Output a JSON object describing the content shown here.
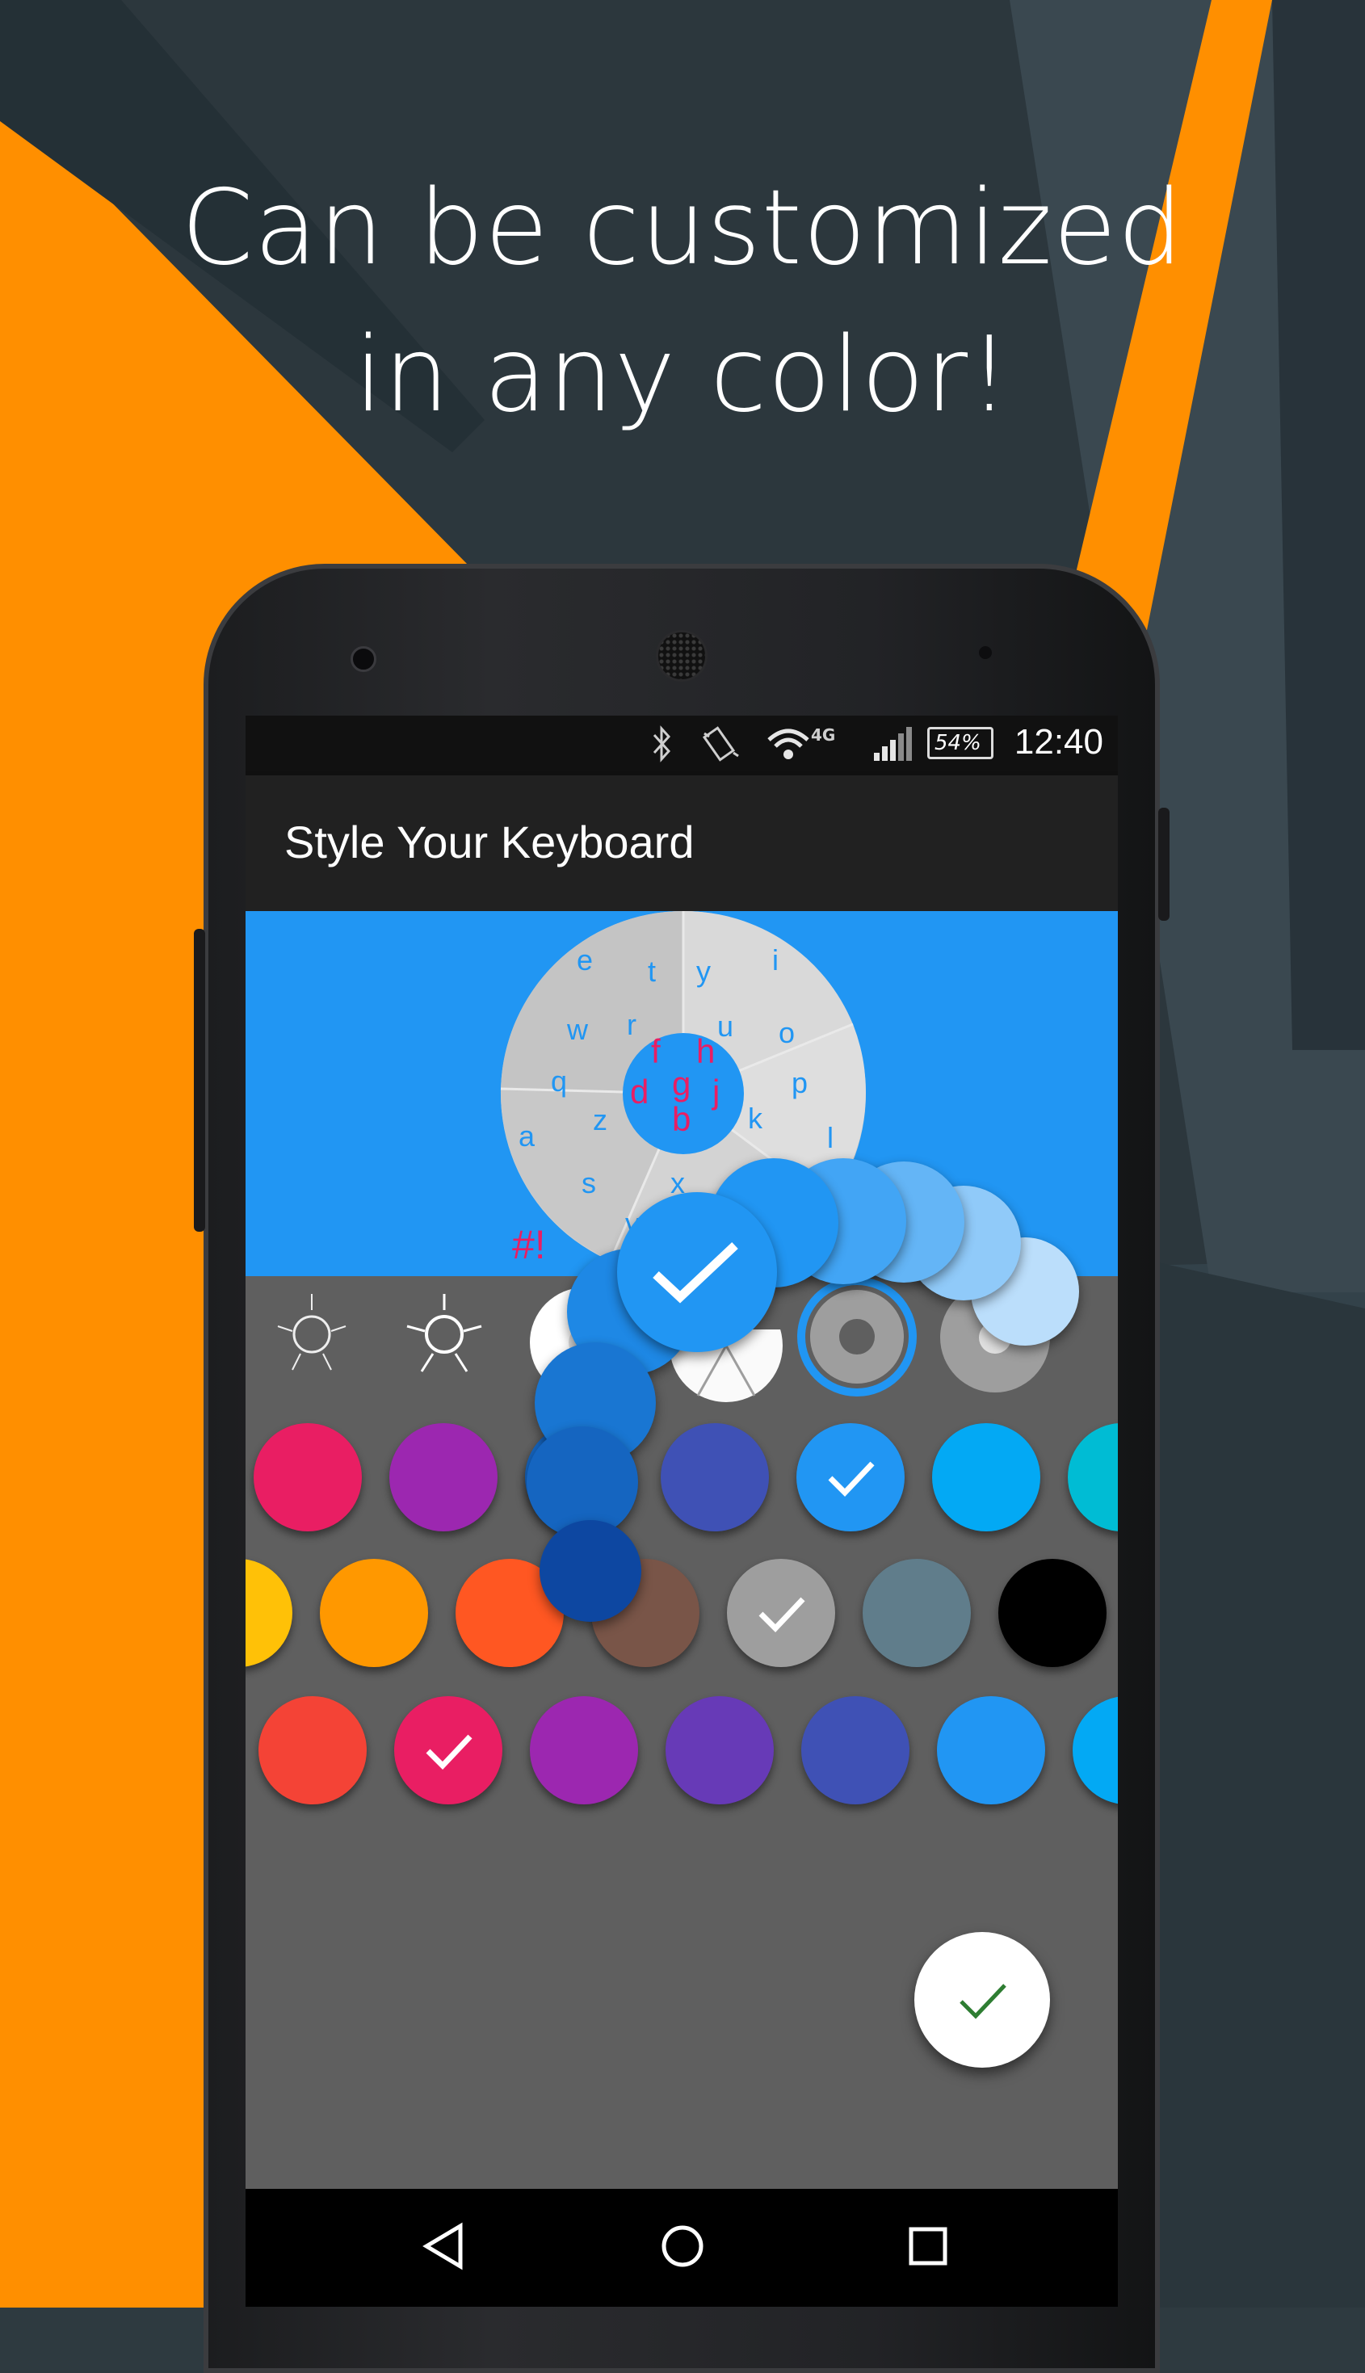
{
  "headline": {
    "line1": "Can be customized",
    "line2": "in any color!"
  },
  "status_bar": {
    "time": "12:40",
    "battery": "54%",
    "network": "4G"
  },
  "app_bar": {
    "title": "Style Your Keyboard"
  },
  "keyboard_preview": {
    "outer_letters": [
      "e",
      "t",
      "y",
      "i",
      "w",
      "r",
      "u",
      "o",
      "q",
      "p",
      "a",
      "z",
      "k",
      "l",
      "s",
      "x",
      "v"
    ],
    "center_letters": [
      "f",
      "h",
      "d",
      "g",
      "j",
      "b"
    ],
    "symbols_key": "#!"
  },
  "style_options": [
    {
      "name": "light-theme-outline",
      "selected": false
    },
    {
      "name": "light-theme-outline-2",
      "selected": false
    },
    {
      "name": "white-wheel",
      "selected": false
    },
    {
      "name": "white-wheel-2",
      "selected": false
    },
    {
      "name": "gray-wheel",
      "selected": true
    },
    {
      "name": "gray-wheel-2",
      "selected": false
    }
  ],
  "palette_rows": [
    {
      "colors": [
        "#e91e63",
        "#9c27b0",
        "#1565c0",
        "#3f51b5",
        "#2196f3",
        "#03a9f4",
        "#00bcd4"
      ],
      "selected_index": 4
    },
    {
      "colors": [
        "#ffc107",
        "#ff9800",
        "#ff5722",
        "#795548",
        "#9e9e9e",
        "#607d8b",
        "#000000",
        "#ffffff"
      ],
      "selected_index": 4
    },
    {
      "colors": [
        "#f44336",
        "#e91e63",
        "#9c27b0",
        "#673ab7",
        "#3f51b5",
        "#2196f3",
        "#03a9f4"
      ],
      "selected_index": 1
    }
  ],
  "selection_trail": {
    "colors": [
      "#bbdefb",
      "#90caf9",
      "#64b5f6",
      "#42a5f5",
      "#2196f3",
      "#1e88e5",
      "#1976d2",
      "#1565c0",
      "#0d47a1"
    ],
    "active_color": "#2196f3"
  },
  "colors": {
    "accent_orange": "#ff8f00",
    "app_bar": "#212121",
    "preview_bg": "#2196f3",
    "panel_bg": "#5f5f5f",
    "confirm_check": "#2e7d32"
  },
  "icons": {
    "bluetooth": "bluetooth-icon",
    "vibrate": "vibrate-icon",
    "wifi": "wifi-icon",
    "signal": "signal-icon",
    "battery": "battery-icon",
    "back": "back-icon",
    "home": "home-icon",
    "recents": "recents-icon",
    "confirm": "check-icon"
  }
}
